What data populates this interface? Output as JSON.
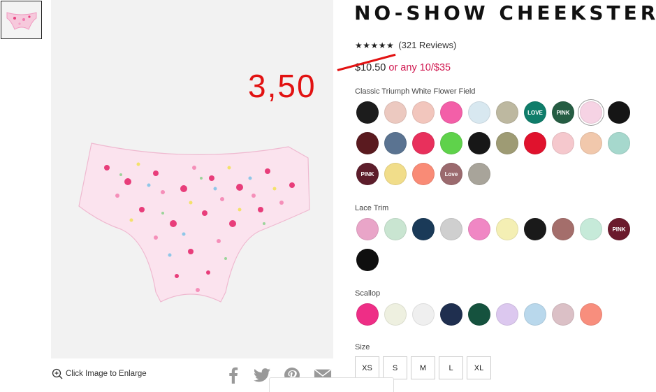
{
  "product": {
    "title": "NO-SHOW CHEEKSTER",
    "stars": "★★★★★",
    "reviews": "(321 Reviews)",
    "old_price": "$10.50",
    "promo": "or any 10/$35"
  },
  "annotation": {
    "new_price": "3,50"
  },
  "media": {
    "enlarge_label": "Click Image to Enlarge"
  },
  "share": [
    "facebook-icon",
    "twitter-icon",
    "pinterest-icon",
    "email-icon"
  ],
  "color_groups": [
    {
      "label": "Classic Triumph White Flower Field",
      "swatches": [
        {
          "color": "#1c1c1c",
          "text": ""
        },
        {
          "color": "#ecc9c0",
          "text": ""
        },
        {
          "color": "#f2c6bd",
          "text": ""
        },
        {
          "color": "#f35fa8",
          "text": ""
        },
        {
          "color": "#d8e8f0",
          "text": ""
        },
        {
          "color": "#bdb8a0",
          "text": ""
        },
        {
          "color": "#0f7d6a",
          "text": "LOVE"
        },
        {
          "color": "#255d43",
          "text": "PINK"
        },
        {
          "color": "#f6d3e4",
          "text": "",
          "selected": true
        },
        {
          "color": "#151515",
          "text": ""
        },
        {
          "color": "#5a1a1f",
          "text": ""
        },
        {
          "color": "#5a7391",
          "text": ""
        },
        {
          "color": "#e8305c",
          "text": ""
        },
        {
          "color": "#5fd24b",
          "text": ""
        },
        {
          "color": "#171717",
          "text": ""
        },
        {
          "color": "#9e9b74",
          "text": ""
        },
        {
          "color": "#e0122d",
          "text": ""
        },
        {
          "color": "#f5c8cd",
          "text": ""
        },
        {
          "color": "#f1c8ac",
          "text": ""
        },
        {
          "color": "#a6d8cd",
          "text": ""
        },
        {
          "color": "#5d1d2b",
          "text": "PINK"
        },
        {
          "color": "#f1dd8a",
          "text": ""
        },
        {
          "color": "#f98b76",
          "text": ""
        },
        {
          "color": "#9b6a6e",
          "text": "Love"
        },
        {
          "color": "#a8a49a",
          "text": ""
        }
      ]
    },
    {
      "label": "Lace Trim",
      "swatches": [
        {
          "color": "#e9a5c8",
          "text": ""
        },
        {
          "color": "#c9e5d1",
          "text": ""
        },
        {
          "color": "#1a3a58",
          "text": ""
        },
        {
          "color": "#cfcfcf",
          "text": ""
        },
        {
          "color": "#f087c4",
          "text": ""
        },
        {
          "color": "#f4efb4",
          "text": ""
        },
        {
          "color": "#1a1a1a",
          "text": ""
        },
        {
          "color": "#a46e6b",
          "text": ""
        },
        {
          "color": "#c6ead9",
          "text": ""
        },
        {
          "color": "#6b1a2c",
          "text": "PINK"
        },
        {
          "color": "#0f0f0f",
          "text": ""
        }
      ]
    },
    {
      "label": "Scallop",
      "swatches": [
        {
          "color": "#ee2e86",
          "text": ""
        },
        {
          "color": "#eef0e0",
          "text": ""
        },
        {
          "color": "#efefef",
          "text": ""
        },
        {
          "color": "#1f2f4f",
          "text": ""
        },
        {
          "color": "#15523e",
          "text": ""
        },
        {
          "color": "#dcc8ef",
          "text": ""
        },
        {
          "color": "#b9d8ec",
          "text": ""
        },
        {
          "color": "#dbc0c6",
          "text": ""
        },
        {
          "color": "#f88e7d",
          "text": ""
        }
      ]
    }
  ],
  "size": {
    "label": "Size",
    "options": [
      "XS",
      "S",
      "M",
      "L",
      "XL"
    ]
  }
}
